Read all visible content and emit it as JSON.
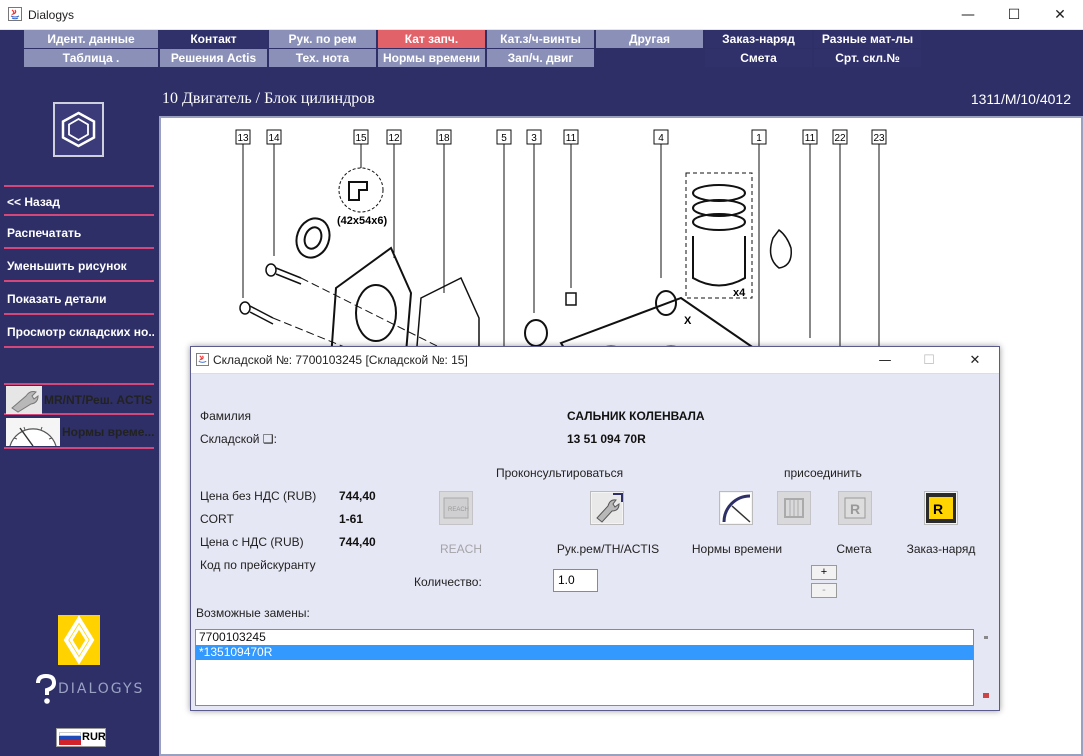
{
  "window": {
    "title": "Dialogys"
  },
  "menu": {
    "row1": [
      "Идент. данные",
      "Контакт",
      "Рук. по рем",
      "Кат запч.",
      "Кат.з/ч-винты",
      "Другая",
      "Заказ-наряд",
      "Разные мат-лы"
    ],
    "row2": [
      "Таблица .",
      "Решения Actis",
      "Тех. нота",
      "Нормы времени",
      "Зап/ч. двиг",
      "",
      "Смета",
      "Срт. скл.№"
    ]
  },
  "sidebar": {
    "buttons": [
      "<< Назад",
      "Распечатать",
      "Уменьшить рисунок",
      "Показать детали",
      "Просмотр складских но..."
    ],
    "image_buttons": [
      "MR/NT/Реш. ACTIS",
      "Нормы време..."
    ],
    "brand": "DIALOGYS",
    "currency": "RUR"
  },
  "content": {
    "title": "10 Двигатель / Блок цилиндров",
    "code": "1311/M/10/4012"
  },
  "diagram": {
    "callouts": [
      "13",
      "14",
      "15",
      "12",
      "18",
      "5",
      "3",
      "11",
      "4",
      "1",
      "11",
      "22",
      "23"
    ],
    "dims_label": "(42x54x6)",
    "qty_label": "x4",
    "axis_label": "X"
  },
  "dialog": {
    "title": "Складской №: 7700103245 [Складской №: 15]",
    "family_label": "Фамилия",
    "family_value": "САЛЬНИК КОЛЕНВАЛА",
    "stock_label": "Складской ❑:",
    "stock_value": "13 51 094 70R",
    "consult_label": "Проконсультироваться",
    "attach_label": "присоединить",
    "price_no_vat_label": "Цена без НДС (RUB)",
    "price_no_vat_value": "744,40",
    "cort_label": "CORT",
    "cort_value": "1-61",
    "price_vat_label": "Цена с НДС (RUB)",
    "price_vat_value": "744,40",
    "pricelist_label": "Код по прейскуранту",
    "qty_label": "Количество:",
    "qty_value": "1.0",
    "plus": "+",
    "minus": "-",
    "replacements_label": "Возможные замены:",
    "replacements": [
      "7700103245",
      "*135109470R"
    ],
    "actions": {
      "reach": "REACH",
      "manual": "Рук.рем/TH/ACTIS",
      "labour": "Нормы времени",
      "estimate": "Смета",
      "order": "Заказ-наряд"
    }
  }
}
